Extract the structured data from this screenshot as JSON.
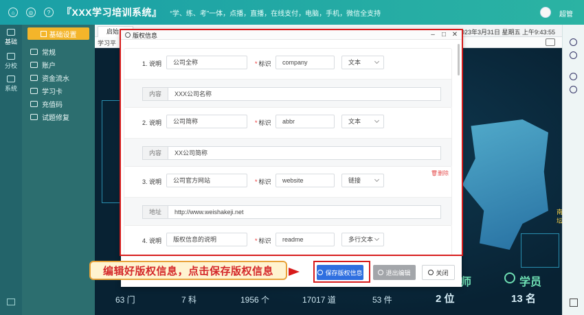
{
  "app": {
    "title": "『XXX学习培训系统』",
    "slogan": "“学、练、考”一体，点播，直播，在线支付，电脑，手机，微信全支持",
    "username": "超管"
  },
  "rail": [
    {
      "label": "基础",
      "icon": "home-icon"
    },
    {
      "label": "分校",
      "icon": "building-icon"
    },
    {
      "label": "系统",
      "icon": "gear-icon"
    }
  ],
  "sidebar": {
    "header": "基础设置",
    "items": [
      {
        "label": "常规",
        "icon": "wrench-icon"
      },
      {
        "label": "账户",
        "icon": "user-icon"
      },
      {
        "label": "资金流水",
        "icon": "money-icon"
      },
      {
        "label": "学习卡",
        "icon": "card-icon"
      },
      {
        "label": "充值码",
        "icon": "coin-icon"
      },
      {
        "label": "试题修复",
        "icon": "repair-icon"
      }
    ]
  },
  "tabs": {
    "home": "启始",
    "current": "学习平",
    "datetime": "2023年3月31日 星期五 上午9:43:55"
  },
  "dashboard": {
    "map_label": "南坛",
    "stats": [
      "63 门",
      "7 科",
      "1956 个",
      "17017 道",
      "53 件",
      "2 位",
      "13 名"
    ],
    "captions": {
      "teacher": "师",
      "learner": "学员"
    }
  },
  "dialog": {
    "title": "版权信息",
    "entries": [
      {
        "num": "1. 说明",
        "desc": "公司全称",
        "key_label": "标识",
        "key": "company",
        "type": "文本",
        "prefix": "内容",
        "value": "XXX公司名称",
        "delete": ""
      },
      {
        "num": "2. 说明",
        "desc": "公司简称",
        "key_label": "标识",
        "key": "abbr",
        "type": "文本",
        "prefix": "内容",
        "value": "XX公司简称",
        "delete": ""
      },
      {
        "num": "3. 说明",
        "desc": "公司官方网站",
        "key_label": "标识",
        "key": "website",
        "type": "链接",
        "prefix": "地址",
        "value": "http://www.weishakeji.net",
        "delete": "删除"
      },
      {
        "num": "4. 说明",
        "desc": "版权信息的说明",
        "key_label": "标识",
        "key": "readme",
        "type": "多行文本",
        "prefix": "",
        "value": "",
        "delete": ""
      }
    ],
    "buttons": {
      "save": "保存版权信息",
      "exit": "退出编辑",
      "close": "关闭"
    }
  },
  "callout": "编辑好版权信息，点击保存版权信息",
  "colors": {
    "accent_red": "#d71b1b",
    "primary_blue": "#2f6fe0",
    "sidebar_header": "#f4b52a",
    "topbar": "#1a9fa6"
  }
}
